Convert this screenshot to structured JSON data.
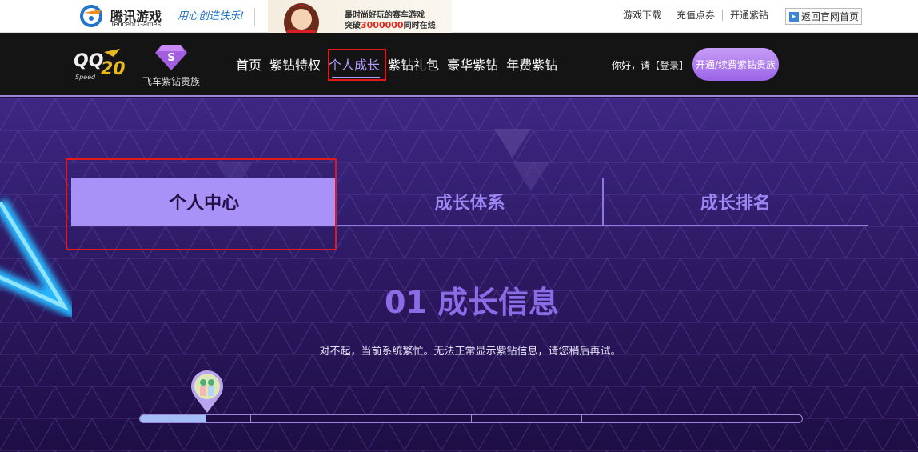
{
  "topbar": {
    "logo_cn": "腾讯游戏",
    "logo_en": "Tencent Games",
    "slogan": "用心创造快乐!",
    "banner": {
      "line1": "最时尚好玩的赛车游戏",
      "line2_prefix": "突破",
      "line2_number": "3000000",
      "line2_suffix": "同时在线"
    },
    "links": [
      "游戏下载",
      "充值点券",
      "开通紫钻"
    ],
    "back_label": "返回官网首页"
  },
  "nav": {
    "gem_label": "飞车紫钻贵族",
    "items": [
      {
        "label": "首页",
        "active": false
      },
      {
        "label": "紫钻特权",
        "active": false
      },
      {
        "label": "个人成长",
        "active": true
      },
      {
        "label": "紫钻礼包",
        "active": false
      },
      {
        "label": "豪华紫钻",
        "active": false
      },
      {
        "label": "年费紫钻",
        "active": false
      }
    ],
    "greeting": "你好，请",
    "login": "【登录】",
    "open_button": "开通/续费紫钻贵族"
  },
  "tabs": [
    {
      "label": "个人中心",
      "active": true
    },
    {
      "label": "成长体系",
      "active": false
    },
    {
      "label": "成长排名",
      "active": false
    }
  ],
  "section": {
    "title": "01 成长信息",
    "message": "对不起，当前系统繁忙。无法正常显示紫钻信息，请您稍后再试。"
  },
  "progress": {
    "fraction": 0.1
  },
  "colors": {
    "accent": "#a892f8",
    "highlight_box": "#e01919",
    "nav_bg": "#141414"
  }
}
